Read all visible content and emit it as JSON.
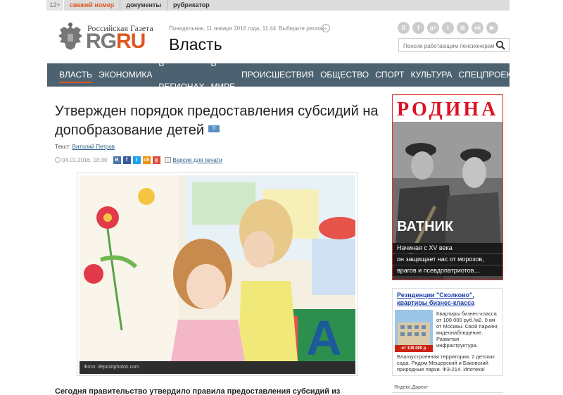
{
  "topbar": {
    "age": "12+",
    "links": [
      "свежий номер",
      "документы",
      "рубрикатор"
    ]
  },
  "header": {
    "logo_sub": "Российская Газета",
    "logo_rg": "RG",
    "logo_ru": "RU",
    "date": "Понедельник, 11 января 2016 года, 11:44",
    "region": "Выберите регион",
    "section": "Власть",
    "social_icons": [
      "vk-icon",
      "facebook-icon",
      "googleplus-icon",
      "twitter-icon",
      "instagram-icon",
      "odnoklassniki-icon",
      "youtube-icon"
    ],
    "search_placeholder": "Пенсии работающим пенсионерам"
  },
  "nav": [
    "ВЛАСТЬ",
    "ЭКОНОМИКА",
    "В РЕГИОНАХ",
    "В МИРЕ",
    "ПРОИСШЕСТВИЯ",
    "ОБЩЕСТВО",
    "СПОРТ",
    "КУЛЬТУРА",
    "СПЕЦПРОЕКТЫ"
  ],
  "article": {
    "headline": "Утвержден порядок предоставления субсидий на допобразование детей",
    "comments": "0",
    "author_label": "Текст:",
    "author": "Виталий Петров",
    "date": "04.01.2016, 18:30",
    "print": "Версия для печати",
    "photo_caption": "Фото: depositphotos.com",
    "lead": "Сегодня правительство утвердило правила предоставления субсидий из"
  },
  "banner": {
    "logo": "РОДИНА",
    "title": "ВАТНИК",
    "lines": [
      "Начиная с XV века",
      "он защищает нас от морозов,",
      "врагов и псевдопатриотов…"
    ]
  },
  "ad": {
    "title": "Резиденции \"Сколково\", квартиры бизнес-класса",
    "text": "Квартиры бизнес-класса от 108 000 руб./м2. 0 км от Москвы. Свой паркинг, видеонаблюдение. Развитая инфраструктура.",
    "text2": "Благоустроенная территория. 2 детских сада. Рядом Мещерский и Баковский природные парки. ФЗ-214. Ипотека!",
    "price": "от 108 000 р"
  },
  "ydirect": "Яндекс.Директ",
  "colors": {
    "accent": "#e0561f",
    "nav_bg": "#4d6270",
    "link": "#2a5d8f"
  }
}
